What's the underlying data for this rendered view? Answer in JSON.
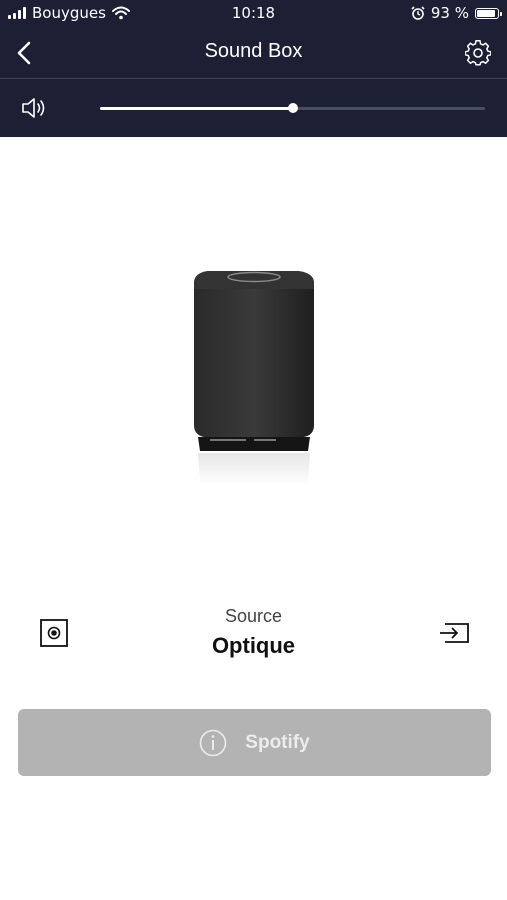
{
  "status_bar": {
    "carrier": "Bouygues",
    "time": "10:18",
    "battery_percent": "93 %",
    "battery_level": 0.93
  },
  "header": {
    "title": "Sound Box"
  },
  "volume": {
    "level": 0.5
  },
  "source": {
    "label": "Source",
    "value": "Optique"
  },
  "spotify": {
    "label": "Spotify",
    "enabled": false
  },
  "colors": {
    "header_bg": "#1d2035",
    "spotify_button_bg": "#b3b3b3"
  }
}
